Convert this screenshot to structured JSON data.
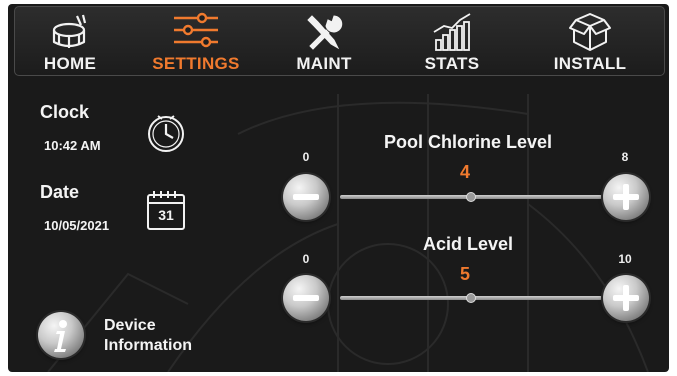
{
  "nav": {
    "tabs": [
      {
        "label": "HOME",
        "icon": "pool-icon"
      },
      {
        "label": "SETTINGS",
        "icon": "sliders-icon"
      },
      {
        "label": "MAINT",
        "icon": "tools-icon"
      },
      {
        "label": "STATS",
        "icon": "bar-chart-icon"
      },
      {
        "label": "INSTALL",
        "icon": "box-icon"
      }
    ],
    "active_tab": "SETTINGS"
  },
  "clock": {
    "label": "Clock",
    "time": "10:42 AM",
    "icon": "clock-icon"
  },
  "date": {
    "label": "Date",
    "value": "10/05/2021",
    "icon": "calendar-icon",
    "calendar_day": "31"
  },
  "chlorine": {
    "title": "Pool Chlorine Level",
    "min": "0",
    "max": "8",
    "value": "4",
    "level": 4
  },
  "acid": {
    "title": "Acid Level",
    "min": "0",
    "max": "10",
    "value": "5",
    "level": 5
  },
  "device_info": {
    "label_line1": "Device",
    "label_line2": "Information",
    "icon": "info-icon"
  },
  "colors": {
    "accent": "#f07a2e",
    "background": "#1a1a1a",
    "text": "#f4f4f4"
  }
}
